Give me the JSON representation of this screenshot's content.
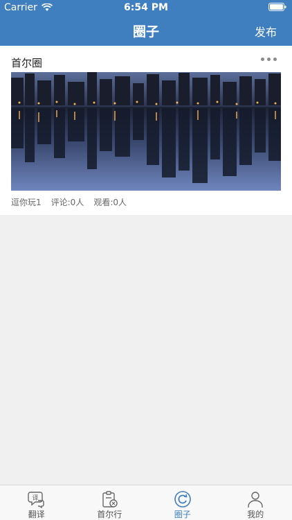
{
  "status_bar": {
    "carrier": "Carrier",
    "time": "6:54 PM"
  },
  "header": {
    "title": "圈子",
    "publish_label": "发布"
  },
  "post": {
    "title": "首尔圈",
    "author": "逗你玩1",
    "comments": "评论:0人",
    "views": "观看:0人"
  },
  "tabs": [
    {
      "label": "翻译",
      "icon": "translate-icon"
    },
    {
      "label": "首尔行",
      "icon": "clipboard-icon"
    },
    {
      "label": "圈子",
      "icon": "refresh-circle-icon",
      "active": true
    },
    {
      "label": "我的",
      "icon": "person-icon"
    }
  ],
  "colors": {
    "accent": "#3f7fbf",
    "background": "#f0f0f0"
  }
}
